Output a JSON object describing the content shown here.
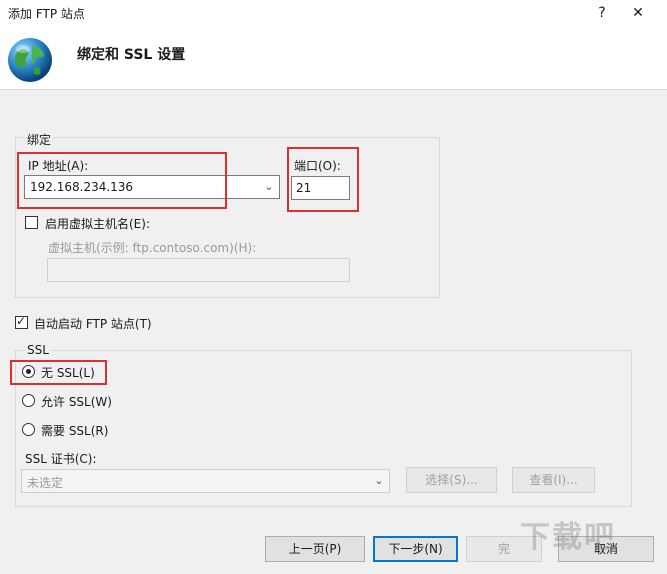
{
  "window": {
    "title": "添加 FTP 站点",
    "help": "?",
    "close": "✕"
  },
  "header": {
    "heading": "绑定和 SSL 设置"
  },
  "binding": {
    "group_title": "绑定",
    "ip_label": "IP 地址(A):",
    "ip_value": "192.168.234.136",
    "port_label": "端口(O):",
    "port_value": "21",
    "virtual_host_checkbox": "启用虚拟主机名(E):",
    "virtual_host_label": "虚拟主机(示例: ftp.contoso.com)(H):",
    "virtual_host_value": ""
  },
  "autostart_label": "自动启动 FTP 站点(T)",
  "ssl": {
    "group_title": "SSL",
    "options": [
      "无 SSL(L)",
      "允许 SSL(W)",
      "需要 SSL(R)"
    ],
    "selected_index": 0,
    "cert_label": "SSL 证书(C):",
    "cert_value": "未选定",
    "select_button": "选择(S)...",
    "view_button": "查看(I)..."
  },
  "footer": {
    "prev_button": "上一页(P)",
    "next_button": "下一步(N)",
    "finish_button": "完",
    "cancel_button": "取消"
  },
  "watermark": "下载吧",
  "colors": {
    "highlight": "#d93030",
    "accent": "#0078d7",
    "panel": "#f0f0f0"
  }
}
